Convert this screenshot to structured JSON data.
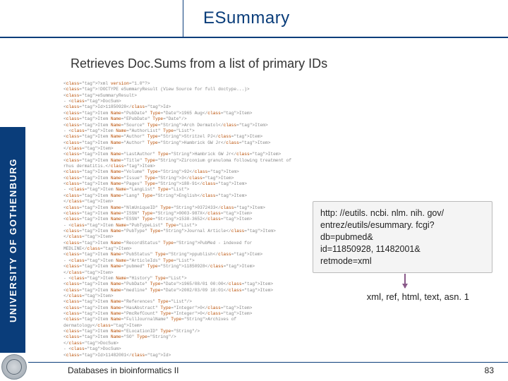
{
  "header": {
    "title": "ESummary"
  },
  "subtitle": "Retrieves Doc.Sums from a list of primary IDs",
  "sidebar": {
    "label": "UNIVERSITY OF GOTHENBURG"
  },
  "xml": {
    "lines": [
      "<?xml version=\"1.0\"?>",
      "<!DOCTYPE eSummaryResult (View Source for full doctype...)>",
      "<eSummaryResult>",
      " - <DocSum>",
      "     <Id>11850928</Id>",
      "     <Item Name=\"PubDate\" Type=\"Date\">1965 Aug</Item>",
      "     <Item Name=\"EPubDate\" Type=\"Date\"/>",
      "     <Item Name=\"Source\" Type=\"String\">Arch Dermatol</Item>",
      "   - <Item Name=\"AuthorList\" Type=\"List\">",
      "       <Item Name=\"Author\" Type=\"String\">Stritzel PJ</Item>",
      "       <Item Name=\"Author\" Type=\"String\">Hambrick GW Jr</Item>",
      "     </Item>",
      "     <Item Name=\"LastAuthor\" Type=\"String\">Hambrick GW Jr</Item>",
      "     <Item Name=\"Title\" Type=\"String\">Zirconium granuloma following treatment of rhus dermatitis.</Item>",
      "     <Item Name=\"Volume\" Type=\"String\">92</Item>",
      "     <Item Name=\"Issue\" Type=\"String\">3</Item>",
      "     <Item Name=\"Pages\" Type=\"String\">188-91</Item>",
      "   - <Item Name=\"LangList\" Type=\"List\">",
      "       <Item Name=\"Lang\" Type=\"String\">English</Item>",
      "     </Item>",
      "     <Item Name=\"NlmUniqueID\" Type=\"String\">0372433</Item>",
      "     <Item Name=\"ISSN\" Type=\"String\">0003-987X</Item>",
      "     <Item Name=\"ESSN\" Type=\"String\">1538-3652</Item>",
      "   - <Item Name=\"PubTypeList\" Type=\"List\">",
      "       <Item Name=\"PubType\" Type=\"String\">Journal Article</Item>",
      "     </Item>",
      "     <Item Name=\"RecordStatus\" Type=\"String\">PubMed - indexed for MEDLINE</Item>",
      "     <Item Name=\"PubStatus\" Type=\"String\">ppublish</Item>",
      "   - <Item Name=\"ArticleIds\" Type=\"List\">",
      "       <Item Name=\"pubmed\" Type=\"String\">11850928</Item>",
      "     </Item>",
      "   - <Item Name=\"History\" Type=\"List\">",
      "       <Item Name=\"PubDate\" Type=\"Date\">1965/08/01 00:00</Item>",
      "       <Item Name=\"medline\" Type=\"Date\">2002/03/09 10:01</Item>",
      "     </Item>",
      "     <Item Name=\"References\" Type=\"List\"/>",
      "     <Item Name=\"HasAbstract\" Type=\"Integer\">0</Item>",
      "     <Item Name=\"PmcRefCount\" Type=\"Integer\">0</Item>",
      "     <Item Name=\"FullJournalName\" Type=\"String\">Archives of dermatology</Item>",
      "     <Item Name=\"ELocationID\" Type=\"String\"/>",
      "     <Item Name=\"SO\" Type=\"String\"/>",
      "   </DocSum>",
      " - <DocSum>",
      "     <Id>11482001</Id>"
    ]
  },
  "linkbox": {
    "l1": "http: //eutils. ncbi. nlm. nih. gov/",
    "l2": "entrez/eutils/esummary. fcgi?",
    "l3": "db=pubmed&",
    "l4": "id=11850928, 11482001&",
    "l5": "retmode=xml"
  },
  "formats": "xml, ref, html, text, asn. 1",
  "footer": {
    "left": "Databases in bioinformatics II",
    "page": "83"
  }
}
